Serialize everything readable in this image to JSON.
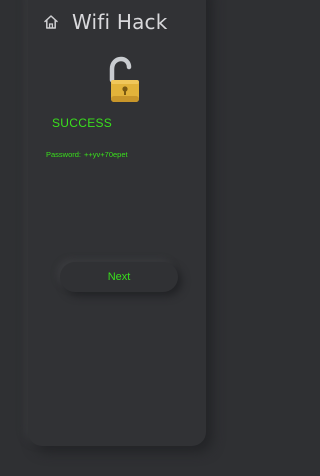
{
  "header": {
    "title": "Wifi Hack",
    "home_icon": "home-icon"
  },
  "status": {
    "icon": "unlocked-padlock-icon",
    "result": "SUCCESS",
    "password_label": "Password:",
    "password_value": "++yv+70epet"
  },
  "actions": {
    "next_label": "Next"
  },
  "colors": {
    "background": "#2f3033",
    "card": "#313235",
    "text": "#d9d9dc",
    "accent": "#39e01c",
    "lock_body": "#e2b33a",
    "lock_shackle": "#c9ccd0"
  }
}
